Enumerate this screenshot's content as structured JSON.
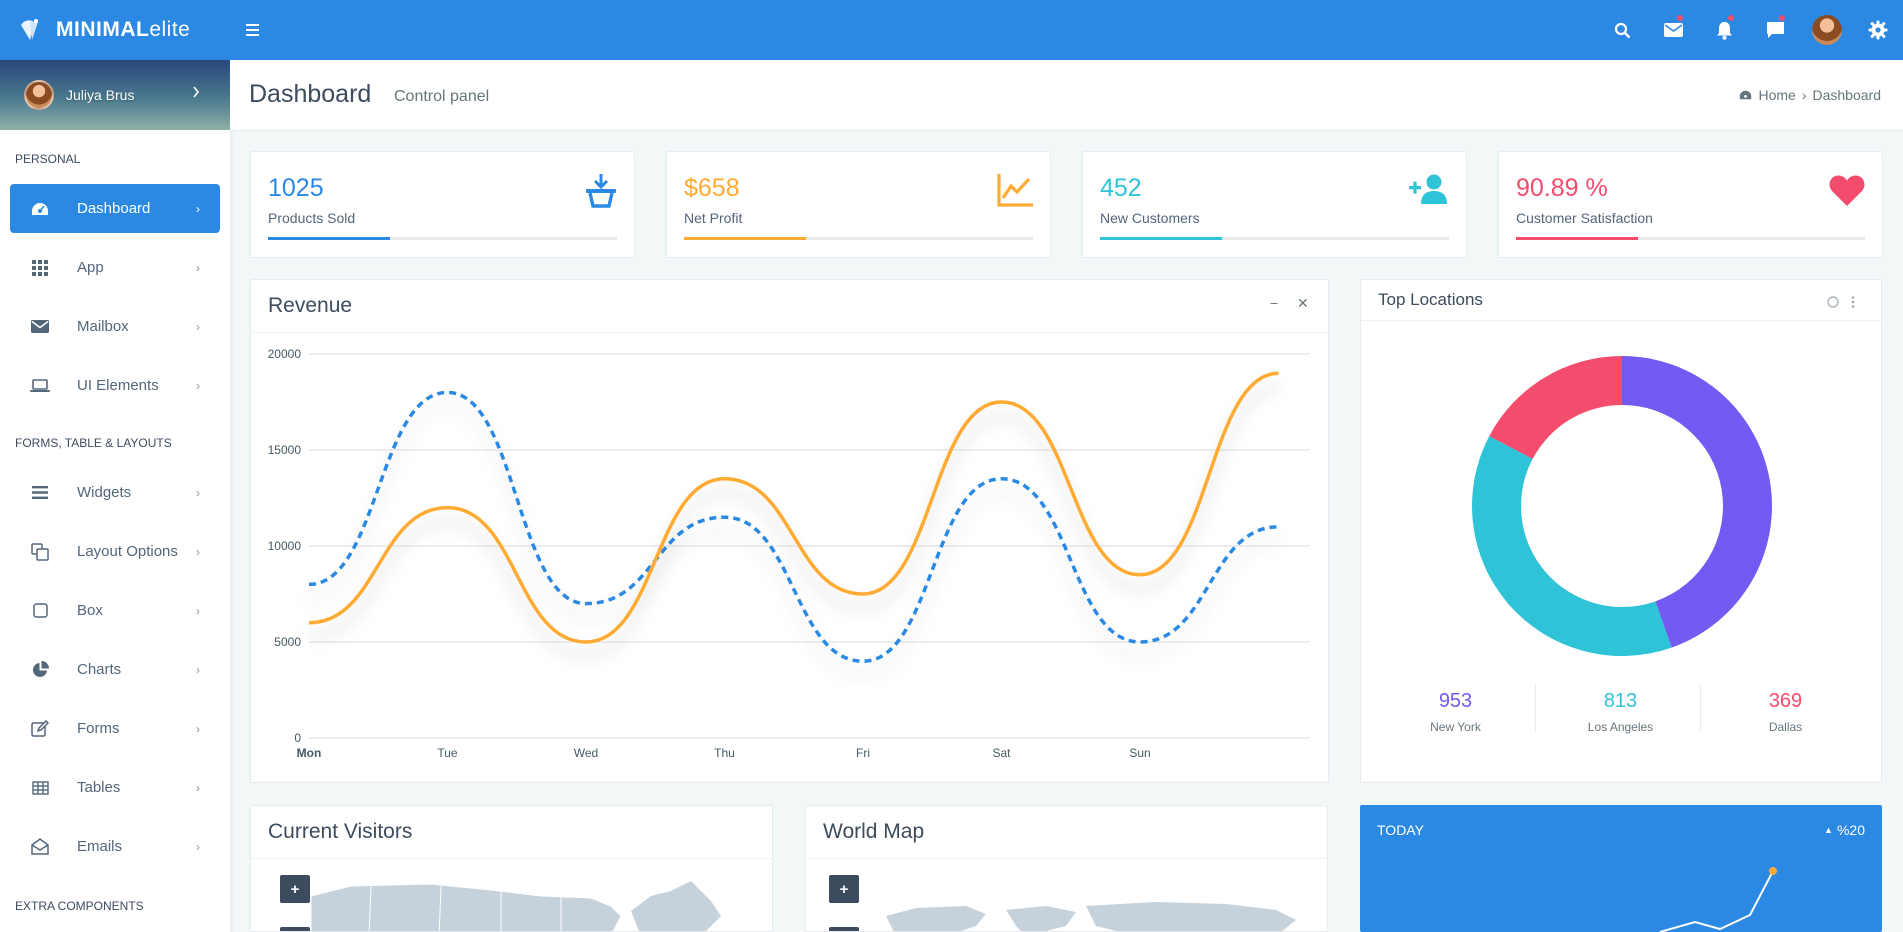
{
  "brand": {
    "name_bold": "MINIMAL",
    "name_light": "elite"
  },
  "user": {
    "name": "Juliya Brus"
  },
  "topbar_icons": [
    "search-icon",
    "mail-icon",
    "bell-icon",
    "chat-icon",
    "avatar",
    "gear-icon"
  ],
  "sidebar": {
    "sections": [
      {
        "caption": "PERSONAL"
      },
      {
        "caption": "FORMS, TABLE & LAYOUTS"
      },
      {
        "caption": "EXTRA COMPONENTS"
      }
    ],
    "items": [
      {
        "label": "Dashboard",
        "icon": "dashboard-icon",
        "active": true
      },
      {
        "label": "App",
        "icon": "grid-icon"
      },
      {
        "label": "Mailbox",
        "icon": "envelope-icon"
      },
      {
        "label": "UI Elements",
        "icon": "laptop-icon"
      },
      {
        "label": "Widgets",
        "icon": "list-icon"
      },
      {
        "label": "Layout Options",
        "icon": "copy-icon"
      },
      {
        "label": "Box",
        "icon": "square-icon"
      },
      {
        "label": "Charts",
        "icon": "pie-chart-icon"
      },
      {
        "label": "Forms",
        "icon": "edit-icon"
      },
      {
        "label": "Tables",
        "icon": "table-icon"
      },
      {
        "label": "Emails",
        "icon": "envelope-open-icon"
      }
    ]
  },
  "header": {
    "title": "Dashboard",
    "subtitle": "Control panel",
    "breadcrumb": [
      "Home",
      "Dashboard"
    ]
  },
  "stats": [
    {
      "value": "1025",
      "label": "Products Sold",
      "color": "#2b89e3",
      "icon": "basket-download-icon",
      "progress": 0.35
    },
    {
      "value": "$658",
      "label": "Net Profit",
      "color": "#ffaa33",
      "icon": "line-chart-icon",
      "progress": 0.35
    },
    {
      "value": "452",
      "label": "New Customers",
      "color": "#2ec3d7",
      "icon": "user-plus-icon",
      "progress": 0.35
    },
    {
      "value": "90.89 %",
      "label": "Customer Satisfaction",
      "color": "#f44c6d",
      "icon": "heart-icon",
      "progress": 0.35
    }
  ],
  "revenue": {
    "title": "Revenue",
    "chart_data": {
      "type": "line",
      "categories": [
        "Mon",
        "Tue",
        "Wed",
        "Thu",
        "Fri",
        "Sat",
        "Sun"
      ],
      "ylim": [
        0,
        20000
      ],
      "yticks": [
        "0",
        "5000",
        "10000",
        "15000",
        "20000"
      ],
      "series": [
        {
          "color": "#2b89e3",
          "dashed": true,
          "values": [
            8000,
            18000,
            7000,
            11500,
            4000,
            13500,
            5000,
            11000
          ]
        },
        {
          "color": "#ffaa33",
          "dashed": false,
          "values": [
            6000,
            12000,
            5000,
            13500,
            7500,
            17500,
            8500,
            19000
          ]
        }
      ]
    }
  },
  "top_locations": {
    "title": "Top Locations",
    "chart_data": {
      "type": "pie",
      "labels": [
        "New York",
        "Los Angeles",
        "Dallas"
      ],
      "values": [
        953,
        813,
        369
      ],
      "colors": [
        "#745af2",
        "#2ec3d7",
        "#f44c6d"
      ]
    },
    "stats": [
      {
        "value": "953",
        "label": "New York",
        "color": "#745af2"
      },
      {
        "value": "813",
        "label": "Los Angeles",
        "color": "#2ec3d7"
      },
      {
        "value": "369",
        "label": "Dallas",
        "color": "#f44c6d"
      }
    ]
  },
  "visitors": {
    "title": "Current Visitors",
    "zoom_in": "+",
    "zoom_out": "−"
  },
  "world_map": {
    "title": "World Map",
    "zoom_in": "+",
    "zoom_out": "−"
  },
  "today": {
    "title": "TODAY",
    "change": "%20"
  }
}
